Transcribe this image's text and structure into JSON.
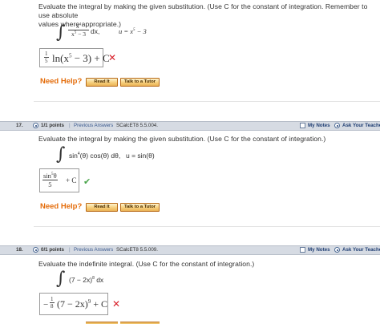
{
  "q16": {
    "prompt_line1": "Evaluate the integral by making the given substitution. (Use C for the constant of integration. Remember to use absolute",
    "prompt_line2": "values where appropriate.)",
    "integrand_num": "x4",
    "integrand_den": "x5 − 3",
    "dx": "dx,",
    "substitution": "u = x5 − 3",
    "answer_coef_num": "1",
    "answer_coef_den": "5",
    "answer_body": "ln(x5 − 3) + C",
    "status_icon": "x-mark-icon",
    "need_help": "Need Help?",
    "read_it": "Read It",
    "talk_to_tutor": "Talk to a Tutor"
  },
  "q17": {
    "number": "17.",
    "points": "1/1 points",
    "sep": "|",
    "previous_answers": "Previous Answers",
    "code": "SCalcET8 5.5.004.",
    "my_notes": "My Notes",
    "ask_teacher": "Ask Your Teacher",
    "prompt": "Evaluate the integral by making the given substitution. (Use C for the constant of integration.)",
    "integrand": "sin4(θ) cos(θ) dθ,",
    "substitution": "u = sin(θ)",
    "answer_num": "sin5θ",
    "answer_den": "5",
    "answer_tail": "+ C",
    "status_icon": "check-icon",
    "need_help": "Need Help?",
    "read_it": "Read It",
    "talk_to_tutor": "Talk to a Tutor"
  },
  "q18": {
    "number": "18.",
    "points": "0/1 points",
    "sep": "|",
    "previous_answers": "Previous Answers",
    "code": "SCalcET8 5.5.009.",
    "my_notes": "My Notes",
    "ask_teacher": "Ask Your Teacher",
    "prompt": "Evaluate the indefinite integral. (Use C for the constant of integration.)",
    "integrand": "(7 − 2x)8 dx",
    "answer_sign": "−",
    "answer_coef_num": "1",
    "answer_coef_den": "8",
    "answer_body": "(7 − 2x)9 + C",
    "status_icon": "x-mark-icon"
  },
  "colors": {
    "header_bg": "#d6dbe3",
    "link": "#3b5a8f",
    "help_orange": "#e46c0a",
    "wrong_red": "#d9232d",
    "correct_green": "#49a44a"
  }
}
